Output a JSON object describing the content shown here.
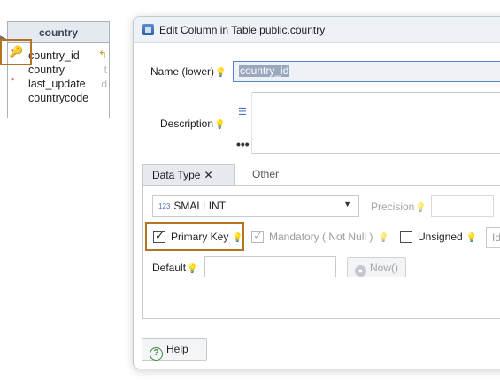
{
  "er_table": {
    "title": "country",
    "columns": [
      {
        "name": "country_id",
        "type": "",
        "mark": "*"
      },
      {
        "name": "country",
        "type": "t",
        "mark": ""
      },
      {
        "name": "last_update",
        "type": "d",
        "mark": "*"
      },
      {
        "name": "countrycode",
        "type": "c",
        "mark": ""
      }
    ]
  },
  "dialog": {
    "title": "Edit Column in Table public.country",
    "name_label": "Name (lower)",
    "name_value": "country_id",
    "description_label": "Description",
    "ellipsis": "•••",
    "tabs": [
      {
        "label": "Data Type",
        "close": "✕"
      },
      {
        "label": "Other"
      }
    ],
    "data_type": {
      "icon_text": "123",
      "value": "SMALLINT",
      "caret": "▼"
    },
    "precision_label": "Precision",
    "primary_key_label": "Primary Key",
    "mandatory_label": "Mandatory ( Not Null )",
    "unsigned_label": "Unsigned",
    "extra_input_value": "Id",
    "default_label": "Default",
    "now_button_label": "Now()",
    "help_button_label": "Help",
    "colors": {
      "highlight": "#b5731f",
      "input_focus_border": "#5a82c4",
      "bulb": "#f0c43a"
    }
  }
}
